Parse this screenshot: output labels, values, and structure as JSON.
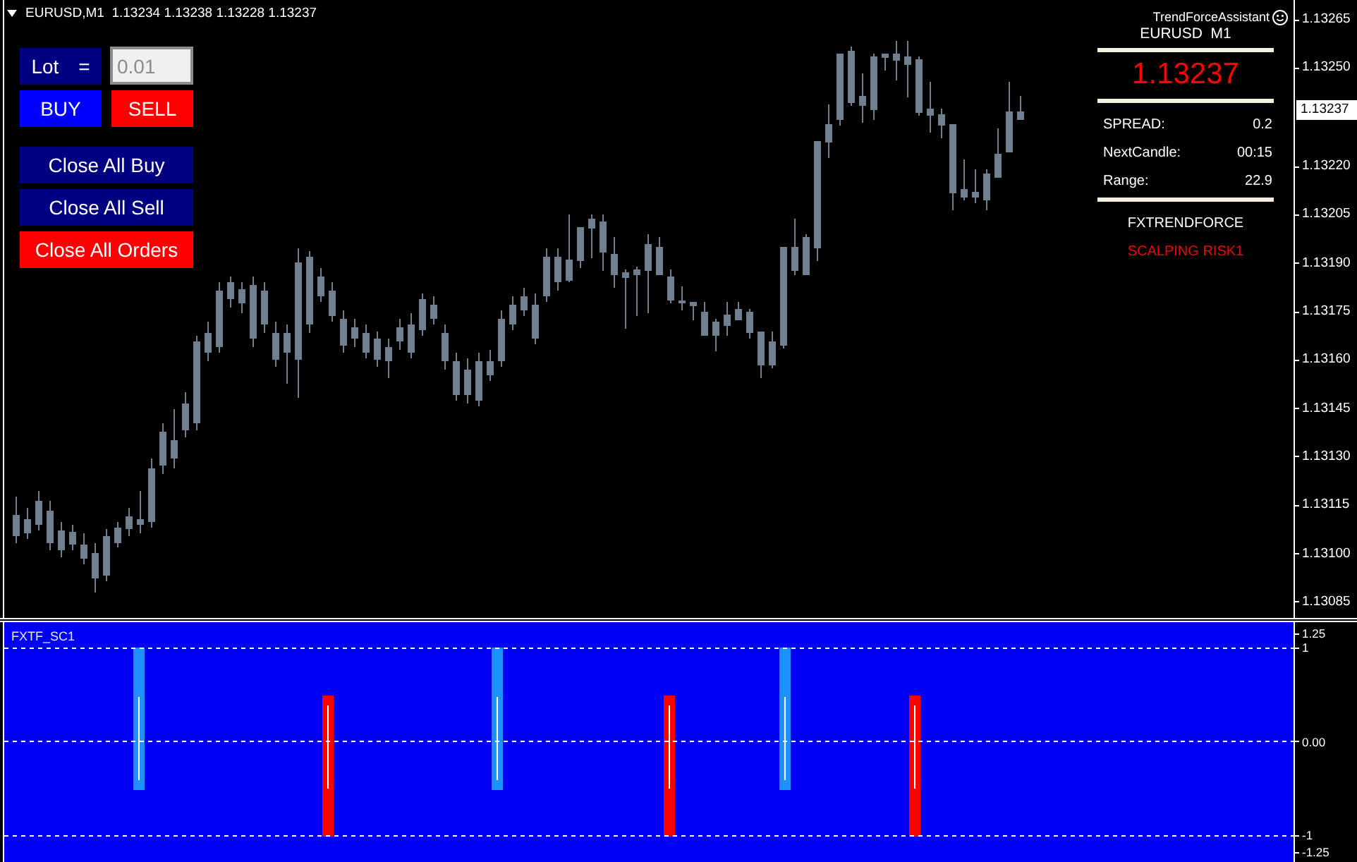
{
  "chart": {
    "header": "EURUSD,M1  1.13234 1.13238 1.13228 1.13237"
  },
  "trade_panel": {
    "lot_label": "Lot =",
    "lot_value": "0.01",
    "order_buttons": [
      {
        "label": "BUY",
        "color": "#0000ff"
      },
      {
        "label": "SELL",
        "color": "#ff0000"
      }
    ],
    "close_buttons": [
      {
        "label": "Close All Buy",
        "color": "#000080"
      },
      {
        "label": "Close All Sell",
        "color": "#000080"
      },
      {
        "label": "Close All Orders",
        "color": "#ff0000"
      }
    ]
  },
  "info_panel": {
    "title": "TrendForceAssistant",
    "symbol": "EURUSD  M1",
    "price": "1.13237",
    "stats": [
      {
        "label": "SPREAD:",
        "value": "0.2"
      },
      {
        "label": "NextCandle:",
        "value": "00:15"
      },
      {
        "label": "Range:",
        "value": "22.9"
      }
    ],
    "brand": "FXTRENDFORCE",
    "mode": "SCALPING RISK1"
  },
  "price_axis": {
    "upper_labels": [
      "1.13265",
      "1.13250"
    ],
    "current_price": "1.13237",
    "lower_labels": [
      "1.13220",
      "1.13205",
      "1.13190",
      "1.13175",
      "1.13160",
      "1.13145",
      "1.13130",
      "1.13115",
      "1.13100",
      "1.13085"
    ]
  },
  "indicator": {
    "title": "FXTF_SC1",
    "axis": {
      "max": "1.25",
      "levels": [
        "1",
        "0.00",
        "-1"
      ],
      "min": "-1.25"
    }
  }
}
